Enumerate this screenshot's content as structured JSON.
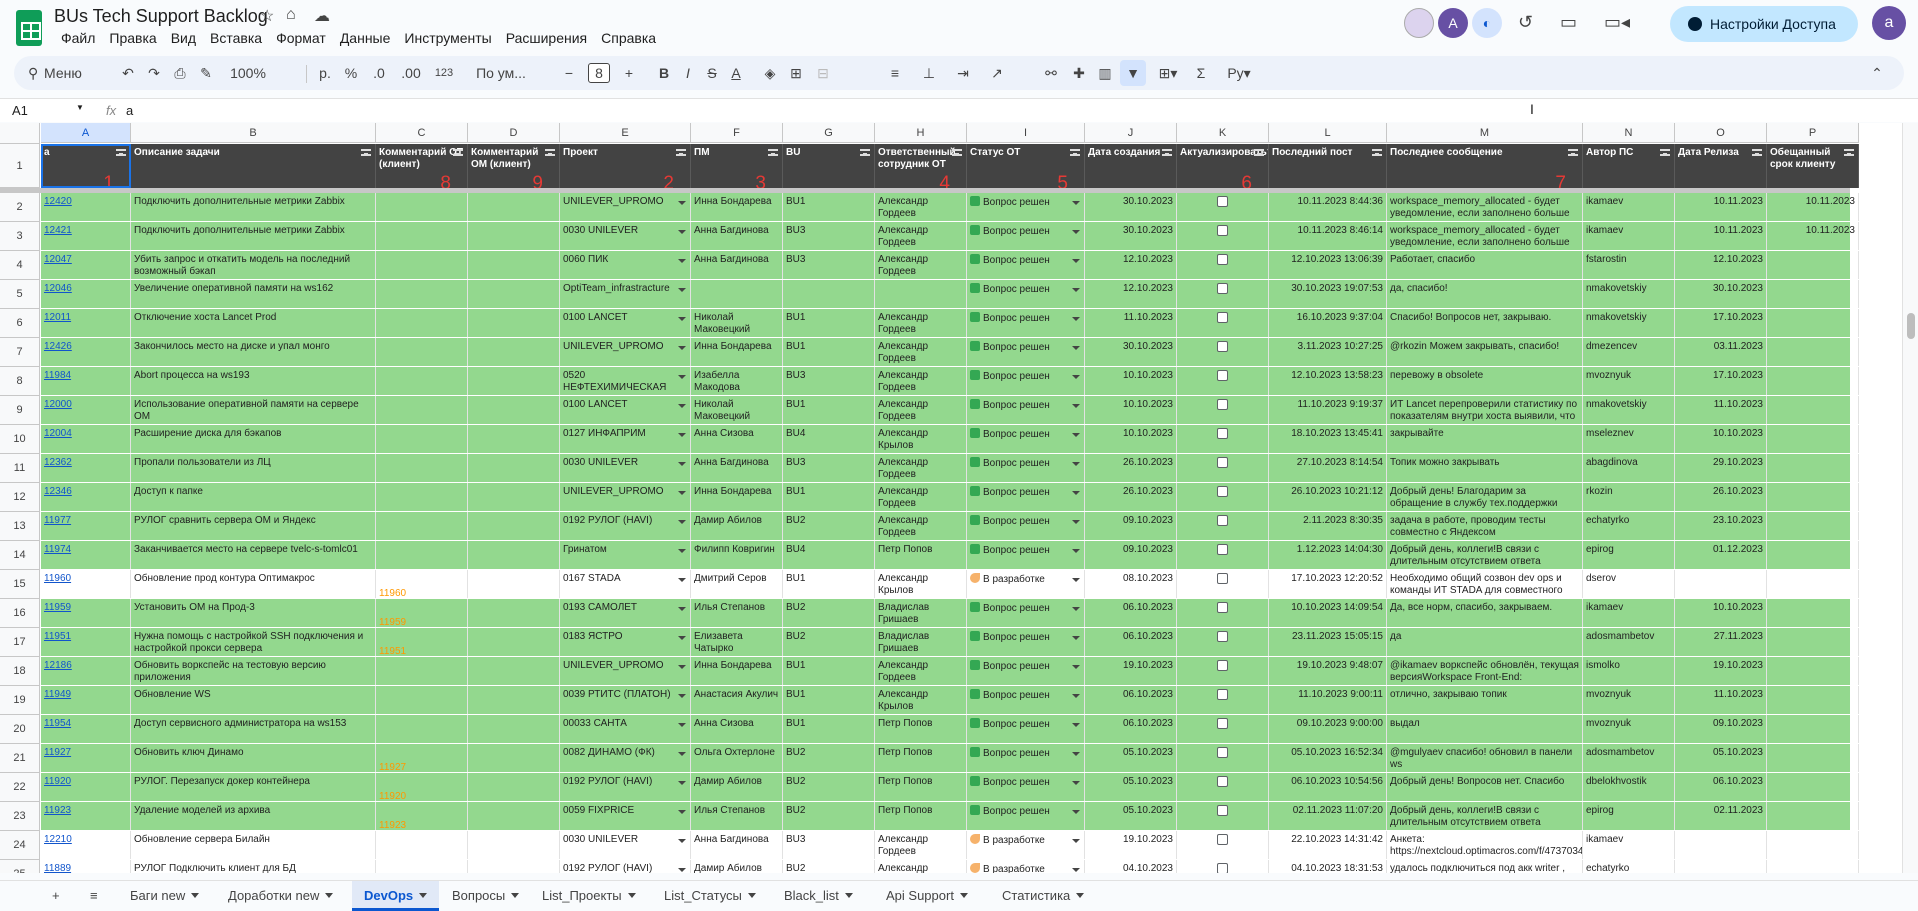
{
  "title": "BUs Tech Support Backlog",
  "menu": [
    "Файл",
    "Правка",
    "Вид",
    "Вставка",
    "Формат",
    "Данные",
    "Инструменты",
    "Расширения",
    "Справка"
  ],
  "share_label": "Настройки Доступа",
  "avatar_letter": "a",
  "avatar_letter_b": "A",
  "toolbar": {
    "search": "Меню",
    "zoom": "100%",
    "currency": "р.",
    "percent": "%",
    "dec_less": ".0",
    "dec_more": ".00",
    "num_fmt": "123",
    "font": "По ум...",
    "font_size": "8",
    "bold": "B",
    "italic": "I",
    "strike": "S",
    "textcolor": "A",
    "sigma": "Σ"
  },
  "formula": {
    "cell_ref": "A1",
    "fx": "fx",
    "value": "a"
  },
  "columns": [
    "A",
    "B",
    "C",
    "D",
    "E",
    "F",
    "G",
    "H",
    "I",
    "J",
    "K",
    "L",
    "M",
    "N",
    "O",
    "P"
  ],
  "headers": [
    "a",
    "Описание задачи",
    "Комментарий ОТ (клиент)",
    "Комментарий ОМ (клиент)",
    "Проект",
    "ПМ",
    "BU",
    "Ответственный сотрудник ОТ",
    "Статус ОТ",
    "Дата создания",
    "Актуализировать?",
    "Последний пост",
    "Последнее сообщение",
    "Автор ПС",
    "Дата Релиза",
    "Обещанный срок клиенту"
  ],
  "markers": {
    "a": "1",
    "pr": "2",
    "pm": "3",
    "ot": "4",
    "st": "5",
    "ak": "6",
    "ms": "7",
    "c": "8",
    "d": "9"
  },
  "status_colors": {
    "done": "#34a853",
    "green_row": "#93d88e",
    "dev_row": "#ffffff"
  },
  "rows": [
    {
      "n": "2",
      "id": "12420",
      "desc": "Подключить дополнительные метрики Zabbix",
      "c": "",
      "proj": "UNILEVER_UPROMO",
      "pm": "Инна Бондарева",
      "bu": "BU1",
      "ot": "Александр Гордеев",
      "st": "Вопрос решен",
      "dev": false,
      "dc": "30.10.2023",
      "lp": "10.11.2023 8:44:36",
      "msg": "workspace_memory_allocated - будет уведомление, если заполнено больше",
      "au": "ikamaev",
      "dr": "10.11.2023",
      "ds": "10.11.2023"
    },
    {
      "n": "3",
      "id": "12421",
      "desc": "Подключить дополнительные метрики Zabbix",
      "c": "",
      "proj": "0030 UNILEVER",
      "pm": "Анна Багдинова",
      "bu": "BU3",
      "ot": "Александр Гордеев",
      "st": "Вопрос решен",
      "dev": false,
      "dc": "30.10.2023",
      "lp": "10.11.2023 8:46:14",
      "msg": "workspace_memory_allocated - будет уведомление, если заполнено больше",
      "au": "ikamaev",
      "dr": "10.11.2023",
      "ds": "10.11.2023"
    },
    {
      "n": "4",
      "id": "12047",
      "desc": "Убить запрос и откатить модель на последний возможный бэкап",
      "c": "",
      "proj": "0060 ПИК",
      "pm": "Анна Багдинова",
      "bu": "BU3",
      "ot": "Александр Гордеев",
      "st": "Вопрос решен",
      "dev": false,
      "dc": "12.10.2023",
      "lp": "12.10.2023 13:06:39",
      "msg": "Работает, спасибо",
      "au": "fstarostin",
      "dr": "12.10.2023",
      "ds": ""
    },
    {
      "n": "5",
      "id": "12046",
      "desc": "Увеличение оперативной памяти на ws162",
      "c": "",
      "proj": "OptiTeam_infrastracture",
      "pm": "",
      "bu": "",
      "ot": "",
      "st": "Вопрос решен",
      "dev": false,
      "dc": "12.10.2023",
      "lp": "30.10.2023 19:07:53",
      "msg": "да, спасибо!",
      "au": "nmakovetskiy",
      "dr": "30.10.2023",
      "ds": ""
    },
    {
      "n": "6",
      "id": "12011",
      "desc": "Отключение хоста Lancet Prod",
      "c": "",
      "proj": "0100 LANCET",
      "pm": "Николай Маковецкий",
      "bu": "BU1",
      "ot": "Александр Гордеев",
      "st": "Вопрос решен",
      "dev": false,
      "dc": "11.10.2023",
      "lp": "16.10.2023 9:37:04",
      "msg": "Спасибо! Вопросов нет, закрываю.",
      "au": "nmakovetskiy",
      "dr": "17.10.2023",
      "ds": ""
    },
    {
      "n": "7",
      "id": "12426",
      "desc": "Закончилось место на диске и упал монго",
      "c": "",
      "proj": "UNILEVER_UPROMO",
      "pm": "Инна Бондарева",
      "bu": "BU1",
      "ot": "Александр Гордеев",
      "st": "Вопрос решен",
      "dev": false,
      "dc": "30.10.2023",
      "lp": "3.11.2023 10:27:25",
      "msg": "@rkozin Можем закрывать, спасибо!",
      "au": "dmezencev",
      "dr": "03.11.2023",
      "ds": ""
    },
    {
      "n": "8",
      "id": "11984",
      "desc": "Abort процесса на ws193",
      "c": "",
      "proj": "0520 НЕФТЕХИМИЧЕСКАЯ",
      "pm": "Изабелла Макодова",
      "bu": "BU3",
      "ot": "Александр Гордеев",
      "st": "Вопрос решен",
      "dev": false,
      "dc": "10.10.2023",
      "lp": "12.10.2023 13:58:23",
      "msg": "перевожу в obsolete",
      "au": "mvoznyuk",
      "dr": "17.10.2023",
      "ds": ""
    },
    {
      "n": "9",
      "id": "12000",
      "desc": "Использование оперативной памяти на сервере ОМ",
      "c": "",
      "proj": "0100 LANCET",
      "pm": "Николай Маковецкий",
      "bu": "BU1",
      "ot": "Александр Гордеев",
      "st": "Вопрос решен",
      "dev": false,
      "dc": "10.10.2023",
      "lp": "11.10.2023 9:19:37",
      "msg": "ИТ Lancet перепроверили статистику по показателям внутри хоста выявили, что",
      "au": "nmakovetskiy",
      "dr": "11.10.2023",
      "ds": ""
    },
    {
      "n": "10",
      "id": "12004",
      "desc": "Расширение диска для бэкапов",
      "c": "",
      "proj": "0127 ИНФАПРИМ",
      "pm": "Анна Сизова",
      "bu": "BU4",
      "ot": "Александр Крылов",
      "st": "Вопрос решен",
      "dev": false,
      "dc": "10.10.2023",
      "lp": "18.10.2023 13:45:41",
      "msg": "закрывайте",
      "au": "mseleznev",
      "dr": "10.10.2023",
      "ds": ""
    },
    {
      "n": "11",
      "id": "12362",
      "desc": "Пропали пользователи из ЛЦ",
      "c": "",
      "proj": "0030 UNILEVER",
      "pm": "Анна Багдинова",
      "bu": "BU3",
      "ot": "Александр Гордеев",
      "st": "Вопрос решен",
      "dev": false,
      "dc": "26.10.2023",
      "lp": "27.10.2023 8:14:54",
      "msg": "Топик можно закрывать",
      "au": "abagdinova",
      "dr": "29.10.2023",
      "ds": ""
    },
    {
      "n": "12",
      "id": "12346",
      "desc": "Доступ к папке",
      "c": "",
      "proj": "UNILEVER_UPROMO",
      "pm": "Инна Бондарева",
      "bu": "BU1",
      "ot": "Александр Гордеев",
      "st": "Вопрос решен",
      "dev": false,
      "dc": "26.10.2023",
      "lp": "26.10.2023 10:21:12",
      "msg": "Добрый день! Благодарим за обращение в службу тех.поддержки Оптимакрос.",
      "au": "rkozin",
      "dr": "26.10.2023",
      "ds": ""
    },
    {
      "n": "13",
      "id": "11977",
      "desc": "РУЛОГ сравнить сервера ОМ и Яндекс",
      "c": "",
      "proj": "0192 РУЛОГ (HAVI)",
      "pm": "Дамир Абилов",
      "bu": "BU2",
      "ot": "Александр Гордеев",
      "st": "Вопрос решен",
      "dev": false,
      "dc": "09.10.2023",
      "lp": "2.11.2023 8:30:35",
      "msg": "задача в работе, проводим тесты совместно с Яндексом",
      "au": "echatyrko",
      "dr": "23.10.2023",
      "ds": ""
    },
    {
      "n": "14",
      "id": "11974",
      "desc": "Заканчивается место на сервере tvelc-s-tomlc01",
      "c": "",
      "proj": "Гринатом",
      "pm": "Филипп Ковригин",
      "bu": "BU4",
      "ot": "Петр Попов",
      "st": "Вопрос решен",
      "dev": false,
      "dc": "09.10.2023",
      "lp": "1.12.2023 14:04:30",
      "msg": "Добрый день, коллеги!В связи с длительным отсутствием ответа",
      "au": "epirog",
      "dr": "01.12.2023",
      "ds": ""
    },
    {
      "n": "15",
      "id": "11960",
      "desc": "Обновление прод контура Оптимакрос",
      "c": "11960",
      "proj": "0167 STADA",
      "pm": "Дмитрий Серов",
      "bu": "BU1",
      "ot": "Александр Крылов",
      "st": "В разработке",
      "dev": true,
      "dc": "08.10.2023",
      "lp": "17.10.2023 12:20:52",
      "msg": "Необходимо общий созвон dev ops и команды ИТ STADA для совместного",
      "au": "dserov",
      "dr": "",
      "ds": ""
    },
    {
      "n": "16",
      "id": "11959",
      "desc": "Установить ОМ на Прод-3",
      "c": "11959",
      "proj": "0193 САМОЛЕТ",
      "pm": "Илья Степанов",
      "bu": "BU2",
      "ot": "Владислав Гришаев",
      "st": "Вопрос решен",
      "dev": false,
      "dc": "06.10.2023",
      "lp": "10.10.2023 14:09:54",
      "msg": "Да, все норм, спасибо, закрываем.",
      "au": "ikamaev",
      "dr": "10.10.2023",
      "ds": ""
    },
    {
      "n": "17",
      "id": "11951",
      "desc": "Нужна помощь с настройкой SSH подключения и настройкой прокси сервера",
      "c": "11951",
      "proj": "0183 ЯСТРО",
      "pm": "Елизавета Чатырко",
      "bu": "BU2",
      "ot": "Владислав Гришаев",
      "st": "Вопрос решен",
      "dev": false,
      "dc": "06.10.2023",
      "lp": "23.11.2023 15:05:15",
      "msg": "да",
      "au": "adosmambetov",
      "dr": "27.11.2023",
      "ds": ""
    },
    {
      "n": "18",
      "id": "12186",
      "desc": "Обновить воркспейс на тестовую версию приложения",
      "c": "",
      "proj": "UNILEVER_UPROMO",
      "pm": "Инна Бондарева",
      "bu": "BU1",
      "ot": "Александр Гордеев",
      "st": "Вопрос решен",
      "dev": false,
      "dc": "19.10.2023",
      "lp": "19.10.2023 9:48:07",
      "msg": "@ikamaev воркспейс обновлён, текущая версияWorkspace Front-End:",
      "au": "ismolko",
      "dr": "19.10.2023",
      "ds": ""
    },
    {
      "n": "19",
      "id": "11949",
      "desc": "Обновление WS",
      "c": "",
      "proj": "0039 РТИТС (ПЛАТОН)",
      "pm": "Анастасия Акулич",
      "bu": "BU1",
      "ot": "Александр Крылов",
      "st": "Вопрос решен",
      "dev": false,
      "dc": "06.10.2023",
      "lp": "11.10.2023 9:00:11",
      "msg": "отлично, закрываю топик",
      "au": "mvoznyuk",
      "dr": "11.10.2023",
      "ds": ""
    },
    {
      "n": "20",
      "id": "11954",
      "desc": "Доступ сервисного администратора на ws153",
      "c": "",
      "proj": "00033 САНТА",
      "pm": "Анна Сизова",
      "bu": "BU1",
      "ot": "Петр Попов",
      "st": "Вопрос решен",
      "dev": false,
      "dc": "06.10.2023",
      "lp": "09.10.2023 9:00:00",
      "msg": "выдал",
      "au": "mvoznyuk",
      "dr": "09.10.2023",
      "ds": ""
    },
    {
      "n": "21",
      "id": "11927",
      "desc": "Обновить ключ Динамо",
      "c": "11927",
      "proj": "0082 ДИНАМО (ФК)",
      "pm": "Ольга Охтерлоне",
      "bu": "BU2",
      "ot": "Петр Попов",
      "st": "Вопрос решен",
      "dev": false,
      "dc": "05.10.2023",
      "lp": "05.10.2023 16:52:34",
      "msg": "@mgulyaev спасибо! обновил в панели ws",
      "au": "adosmambetov",
      "dr": "05.10.2023",
      "ds": ""
    },
    {
      "n": "22",
      "id": "11920",
      "desc": "РУЛОГ. Перезапуск докер контейнера",
      "c": "11920",
      "proj": "0192 РУЛОГ (HAVI)",
      "pm": "Дамир Абилов",
      "bu": "BU2",
      "ot": "Петр Попов",
      "st": "Вопрос решен",
      "dev": false,
      "dc": "05.10.2023",
      "lp": "06.10.2023 10:54:56",
      "msg": "Добрый день! Вопросов нет. Спасибо",
      "au": "dbelokhvostik",
      "dr": "06.10.2023",
      "ds": ""
    },
    {
      "n": "23",
      "id": "11923",
      "desc": "Удаление моделей из архива",
      "c": "11923",
      "proj": "0059 FIXPRICE",
      "pm": "Илья Степанов",
      "bu": "BU2",
      "ot": "Петр Попов",
      "st": "Вопрос решен",
      "dev": false,
      "dc": "05.10.2023",
      "lp": "02.11.2023 11:07:20",
      "msg": "Добрый день, коллеги!В связи с длительным отсутствием ответа",
      "au": "epirog",
      "dr": "02.11.2023",
      "ds": ""
    },
    {
      "n": "24",
      "id": "12210",
      "desc": "Обновление сервера Билайн",
      "c": "",
      "proj": "0030 UNILEVER",
      "pm": "Анна Багдинова",
      "bu": "BU3",
      "ot": "Александр Гордеев",
      "st": "В разработке",
      "dev": true,
      "dc": "19.10.2023",
      "lp": "22.10.2023 14:31:42",
      "msg": "Анкета: https://nextcloud.optimacros.com/f/4737034",
      "au": "ikamaev",
      "dr": "",
      "ds": ""
    },
    {
      "n": "25",
      "id": "11889",
      "desc": "РУЛОГ Подключить клиент для БД",
      "c": "",
      "proj": "0192 РУЛОГ (HAVI)",
      "pm": "Дамир Абилов",
      "bu": "BU2",
      "ot": "Александр Гордеев",
      "st": "В разработке",
      "dev": true,
      "dc": "04.10.2023",
      "lp": "04.10.2023 18:31:53",
      "msg": "удалось подключиться под акк writer ,",
      "au": "echatyrko",
      "dr": "",
      "ds": ""
    }
  ],
  "tabs": [
    "Баги new",
    "Доработки new",
    "DevOps",
    "Вопросы",
    "List_Проекты",
    "List_Статусы",
    "Black_list",
    "Api Support",
    "Статистика"
  ],
  "active_tab": "DevOps"
}
